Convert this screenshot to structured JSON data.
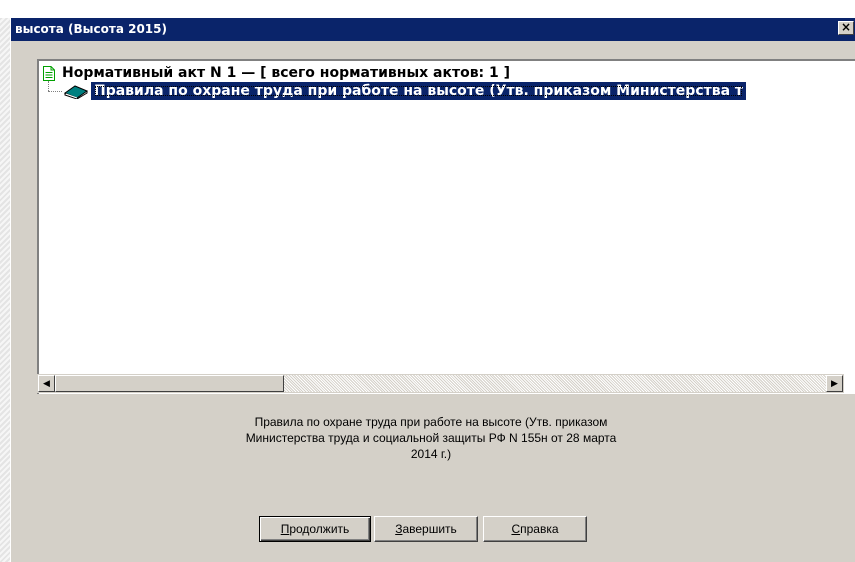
{
  "window": {
    "title": "высота (Высота 2015)",
    "close_label": "×"
  },
  "tree": {
    "root_label": "Нормативный акт N 1 — [ всего нормативных актов: 1 ]",
    "root_icon": "document-icon",
    "child_label": "Правила по охране труда при работе на высоте (Утв. приказом Министерства т",
    "child_icon": "book-icon",
    "child_selected": true
  },
  "scrollbar": {
    "left_arrow": "◀",
    "right_arrow": "▶"
  },
  "description": {
    "lines": [
      "Правила по охране труда при работе на высоте (Утв. приказом",
      "Министерства труда и социальной защиты РФ N 155н от 28 марта",
      "2014 г.)"
    ]
  },
  "buttons": {
    "continue": {
      "accel": "П",
      "rest": "родолжить"
    },
    "finish": {
      "accel": "З",
      "rest": "авершить"
    },
    "help": {
      "accel": "С",
      "rest": "правка"
    }
  },
  "colors": {
    "titlebar": "#0a246a",
    "selection": "#0a246a",
    "face": "#d4d0c8",
    "doc_icon": "#00a000",
    "book_icon": "#008080"
  }
}
